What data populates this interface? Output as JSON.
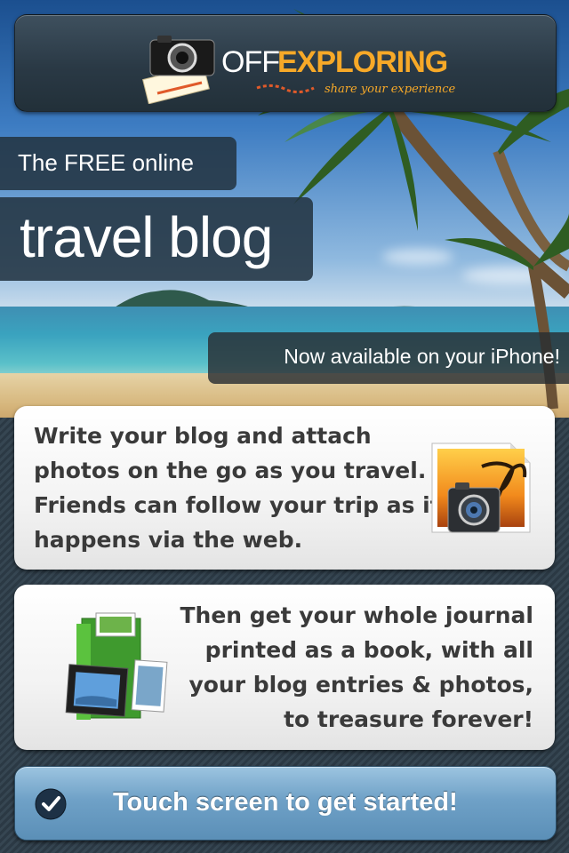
{
  "logo": {
    "off": "OFF",
    "exploring": "EXPLORING",
    "tagline": "share your experience"
  },
  "hero": {
    "line1": "The FREE online",
    "line2": "travel blog",
    "available": "Now available on your iPhone!"
  },
  "card_blog": {
    "lines": [
      "Write your blog and attach",
      "photos on the go as you travel.",
      "Friends can follow your trip as it",
      "happens via the web."
    ]
  },
  "card_book": {
    "lines": [
      "Then get your whole journal",
      "printed as a book, with all",
      "your blog entries & photos,",
      "to treasure forever!"
    ]
  },
  "cta": {
    "label": "Touch screen to get started!"
  },
  "colors": {
    "brand_orange": "#f7a928",
    "header_dark": "#2a3945",
    "cta_blue": "#6fa1c7"
  },
  "icons": [
    "camera-logo-icon",
    "photo-camera-icon",
    "photo-book-icon",
    "checkmark-icon"
  ]
}
